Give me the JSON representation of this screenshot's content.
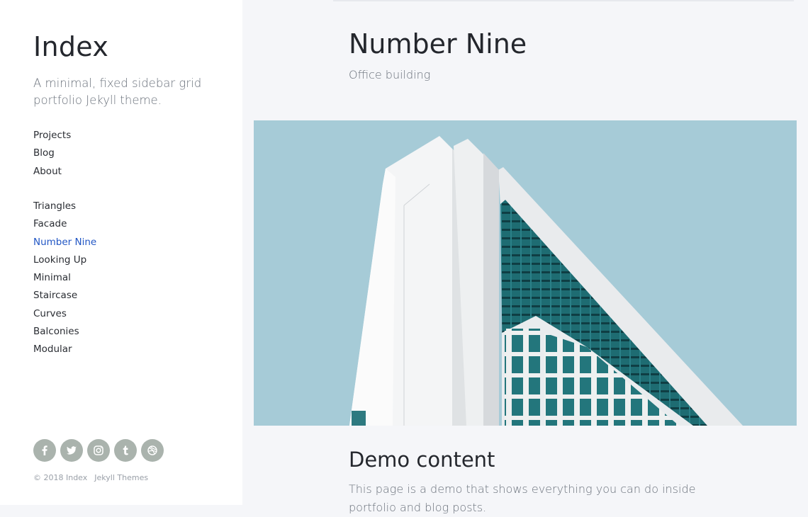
{
  "sidebar": {
    "brand": "Index",
    "tagline": "A minimal, fixed sidebar grid portfolio Jekyll theme.",
    "nav_main": [
      {
        "label": "Projects"
      },
      {
        "label": "Blog"
      },
      {
        "label": "About"
      }
    ],
    "nav_projects": [
      {
        "label": "Triangles"
      },
      {
        "label": "Facade"
      },
      {
        "label": "Number Nine",
        "active": true
      },
      {
        "label": "Looking Up"
      },
      {
        "label": "Minimal"
      },
      {
        "label": "Staircase"
      },
      {
        "label": "Curves"
      },
      {
        "label": "Balconies"
      },
      {
        "label": "Modular"
      }
    ],
    "social": [
      "facebook-icon",
      "twitter-icon",
      "instagram-icon",
      "tumblr-icon",
      "dribbble-icon"
    ],
    "footer": {
      "copyright": "© 2018 Index",
      "link": "Jekyll Themes"
    }
  },
  "main": {
    "title": "Number Nine",
    "subtitle": "Office building",
    "section_title": "Demo content",
    "body": "This page is a demo that shows everything you can do inside portfolio and blog posts."
  },
  "colors": {
    "accent": "#2156c4",
    "sidebar_bg": "#ffffff",
    "content_bg": "#f5f6f9",
    "social_bg": "#aab3ad",
    "sky": "#a6cbd7"
  }
}
